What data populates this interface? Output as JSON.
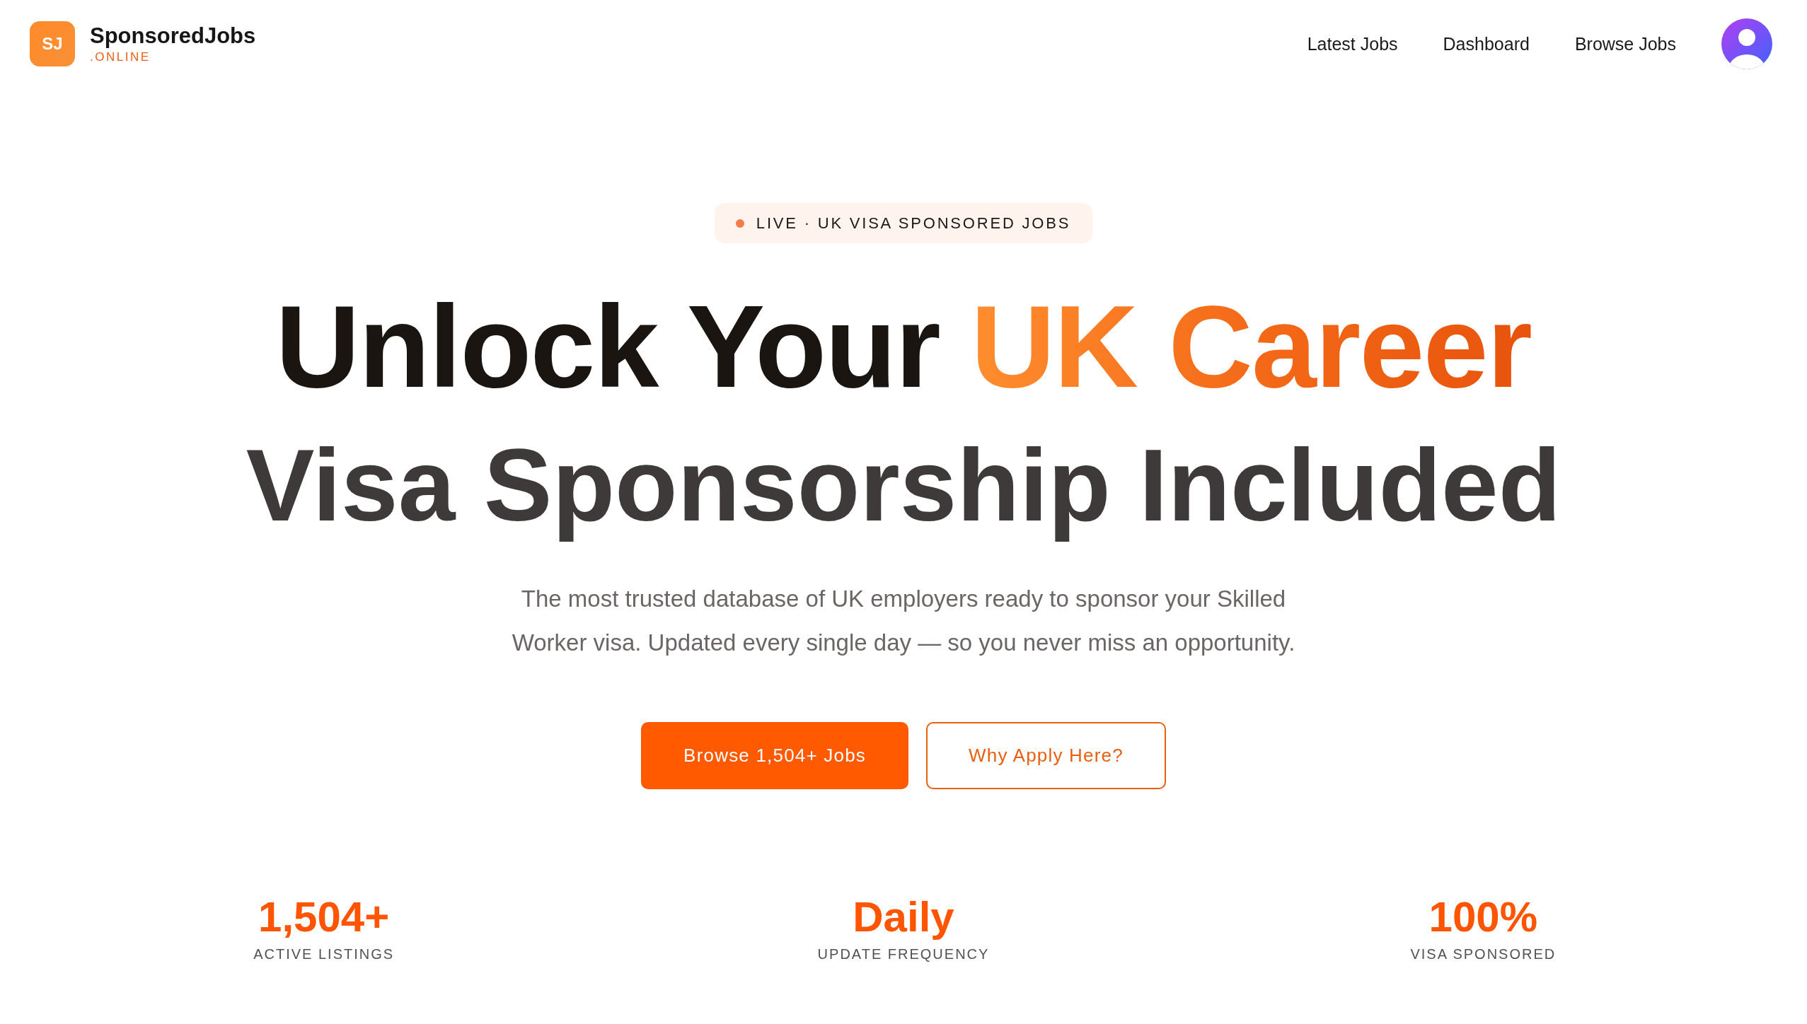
{
  "header": {
    "logo": {
      "mark": "SJ",
      "name": "SponsoredJobs",
      "suffix": ".ONLINE"
    },
    "nav": [
      {
        "label": "Latest Jobs"
      },
      {
        "label": "Dashboard"
      },
      {
        "label": "Browse Jobs"
      }
    ]
  },
  "hero": {
    "badge": {
      "text": "LIVE · UK VISA SPONSORED JOBS"
    },
    "title": {
      "lead": "Unlock Your",
      "highlight": "UK Career"
    },
    "tagline": "Visa Sponsorship Included",
    "description": "The most trusted database of UK employers ready to sponsor your Skilled Worker visa. Updated every single day — so you never miss an opportunity.",
    "buttons": [
      {
        "label": "Browse 1,504+ Jobs",
        "kind": "primary"
      },
      {
        "label": "Why Apply Here?",
        "kind": "outline"
      }
    ]
  },
  "stats": [
    {
      "value": "1,504+",
      "label": "ACTIVE LISTINGS"
    },
    {
      "value": "Daily",
      "label": "UPDATE FREQUENCY"
    },
    {
      "value": "100%",
      "label": "VISA SPONSORED"
    }
  ]
}
